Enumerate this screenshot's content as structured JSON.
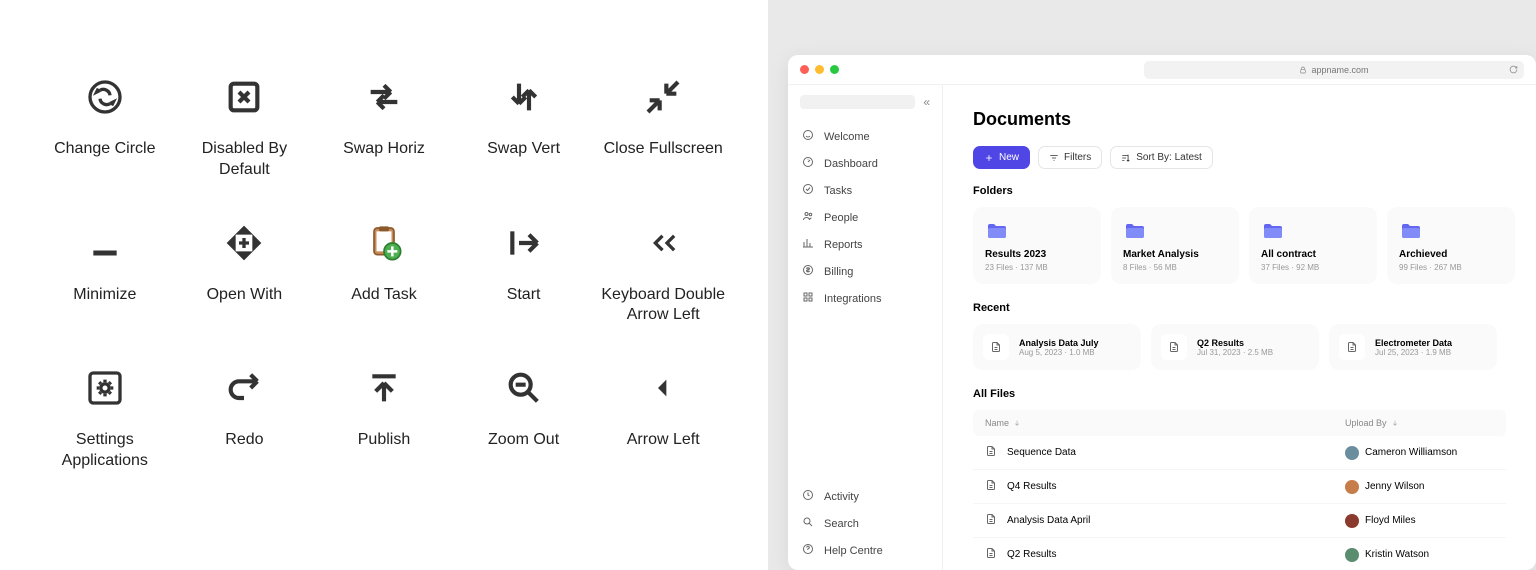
{
  "icons": [
    {
      "id": "change-circle",
      "label": "Change Circle"
    },
    {
      "id": "disabled-by-default",
      "label": "Disabled By Default"
    },
    {
      "id": "swap-horiz",
      "label": "Swap Horiz"
    },
    {
      "id": "swap-vert",
      "label": "Swap Vert"
    },
    {
      "id": "close-fullscreen",
      "label": "Close Fullscreen"
    },
    {
      "id": "minimize",
      "label": "Minimize"
    },
    {
      "id": "open-with",
      "label": "Open With"
    },
    {
      "id": "add-task",
      "label": "Add Task"
    },
    {
      "id": "start",
      "label": "Start"
    },
    {
      "id": "keyboard-double-arrow-left",
      "label": "Keyboard Double Arrow Left"
    },
    {
      "id": "settings-applications",
      "label": "Settings Applications"
    },
    {
      "id": "redo",
      "label": "Redo"
    },
    {
      "id": "publish",
      "label": "Publish"
    },
    {
      "id": "zoom-out",
      "label": "Zoom Out"
    },
    {
      "id": "arrow-left",
      "label": "Arrow Left"
    }
  ],
  "browser": {
    "url": "appname.com"
  },
  "sidebar": {
    "top": [
      {
        "icon": "smile",
        "label": "Welcome"
      },
      {
        "icon": "gauge",
        "label": "Dashboard"
      },
      {
        "icon": "check-circle",
        "label": "Tasks"
      },
      {
        "icon": "users",
        "label": "People"
      },
      {
        "icon": "bar-chart",
        "label": "Reports"
      },
      {
        "icon": "dollar",
        "label": "Billing"
      },
      {
        "icon": "grid",
        "label": "Integrations"
      }
    ],
    "bottom": [
      {
        "icon": "clock",
        "label": "Activity"
      },
      {
        "icon": "search",
        "label": "Search"
      },
      {
        "icon": "help",
        "label": "Help Centre"
      }
    ]
  },
  "page": {
    "title": "Documents"
  },
  "toolbar": {
    "new": "New",
    "filters": "Filters",
    "sort": "Sort By: Latest"
  },
  "sections": {
    "folders": "Folders",
    "recent": "Recent",
    "allfiles": "All Files"
  },
  "folders": [
    {
      "name": "Results 2023",
      "files": "23 Files",
      "size": "137 MB"
    },
    {
      "name": "Market Analysis",
      "files": "8 Files",
      "size": "56 MB"
    },
    {
      "name": "All contract",
      "files": "37 Files",
      "size": "92 MB"
    },
    {
      "name": "Archieved",
      "files": "99 Files",
      "size": "267 MB"
    }
  ],
  "recent": [
    {
      "name": "Analysis Data July",
      "date": "Aug 5, 2023",
      "size": "1.0 MB"
    },
    {
      "name": "Q2 Results",
      "date": "Jul 31, 2023",
      "size": "2.5 MB"
    },
    {
      "name": "Electrometer Data",
      "date": "Jul 25, 2023",
      "size": "1.9 MB"
    }
  ],
  "table": {
    "cols": {
      "name": "Name",
      "upload": "Upload By"
    },
    "rows": [
      {
        "name": "Sequence Data",
        "uploader": "Cameron Williamson",
        "color": "#6b8e9e"
      },
      {
        "name": "Q4 Results",
        "uploader": "Jenny Wilson",
        "color": "#c77d4a"
      },
      {
        "name": "Analysis Data April",
        "uploader": "Floyd Miles",
        "color": "#8b3a2e"
      },
      {
        "name": "Q2 Results",
        "uploader": "Kristin Watson",
        "color": "#5a8c6e"
      }
    ]
  }
}
